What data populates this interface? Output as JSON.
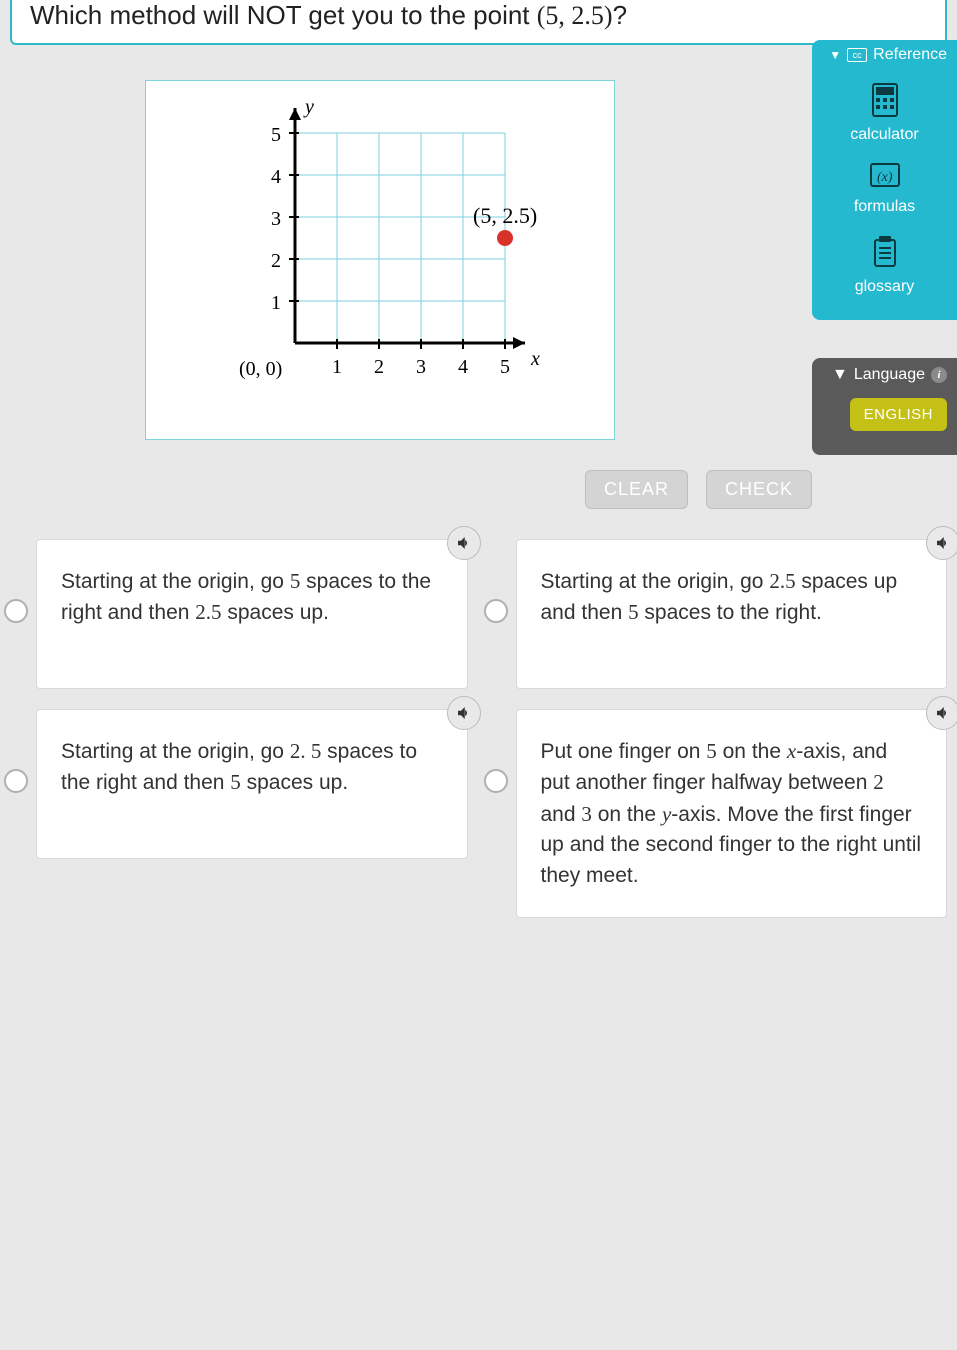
{
  "question": {
    "prefix": "Which method will NOT get you to the point ",
    "point": "(5, 2.5)",
    "suffix": "?"
  },
  "buttons": {
    "clear": "CLEAR",
    "check": "CHECK"
  },
  "graph": {
    "y_label": "y",
    "x_label": "x",
    "origin_label": "(0, 0)",
    "point_label": "(5, 2.5)",
    "x_ticks": [
      "1",
      "2",
      "3",
      "4",
      "5"
    ],
    "y_ticks": [
      "1",
      "2",
      "3",
      "4",
      "5"
    ]
  },
  "answers": [
    {
      "parts": [
        "Starting at the origin, go ",
        "5",
        " spaces to the right and then ",
        "2.5",
        " spaces up."
      ]
    },
    {
      "parts": [
        "Starting at the origin, go ",
        "2.5",
        " spaces up and then ",
        "5",
        " spaces to the right."
      ]
    },
    {
      "parts": [
        "Starting at the origin, go ",
        "2. 5",
        " spaces to the right and then ",
        "5",
        " spaces up."
      ]
    },
    {
      "parts": [
        "Put one finger on ",
        "5",
        " on the ",
        "x",
        "-axis, and put another finger halfway between ",
        "2",
        " and ",
        "3",
        " on the ",
        "y",
        "-axis. Move the first finger up and the second finger to the right until they meet."
      ]
    }
  ],
  "reference": {
    "title": "Reference",
    "items": [
      {
        "label": "calculator"
      },
      {
        "label": "formulas"
      },
      {
        "label": "glossary"
      }
    ]
  },
  "language": {
    "title": "Language",
    "selected": "ENGLISH"
  },
  "chart_data": {
    "type": "scatter",
    "title": "",
    "xlabel": "x",
    "ylabel": "y",
    "xlim": [
      0,
      5
    ],
    "ylim": [
      0,
      5
    ],
    "points": [
      {
        "x": 5,
        "y": 2.5,
        "label": "(5, 2.5)"
      }
    ],
    "origin_label": "(0, 0)"
  }
}
